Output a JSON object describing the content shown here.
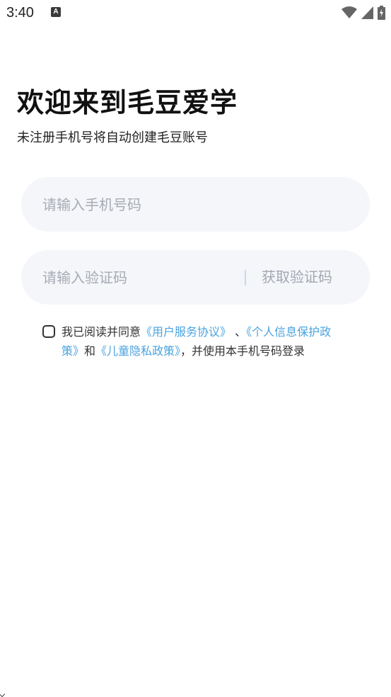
{
  "status_bar": {
    "time": "3:40",
    "notification_icon": "A",
    "icons": [
      "wifi-icon",
      "signal-icon",
      "battery-charging-icon"
    ]
  },
  "login": {
    "title": "欢迎来到毛豆爱学",
    "subtitle": "未注册手机号将自动创建毛豆账号",
    "phone_placeholder": "请输入手机号码",
    "code_placeholder": "请输入验证码",
    "get_code_label": "获取验证码"
  },
  "agreement": {
    "checked": false,
    "prefix": "我已阅读并同意",
    "link_user_agreement": "《用户服务协议》",
    "separator": " 、",
    "link_privacy": "《个人信息保护政策》",
    "and": "和",
    "link_children": "《儿童隐私政策》",
    "suffix": "，并使用本手机号码登录"
  },
  "colors": {
    "link": "#4aa3df",
    "input_bg": "#f4f6fa",
    "placeholder": "#a7abb2",
    "divider": "#c9d8ef"
  }
}
